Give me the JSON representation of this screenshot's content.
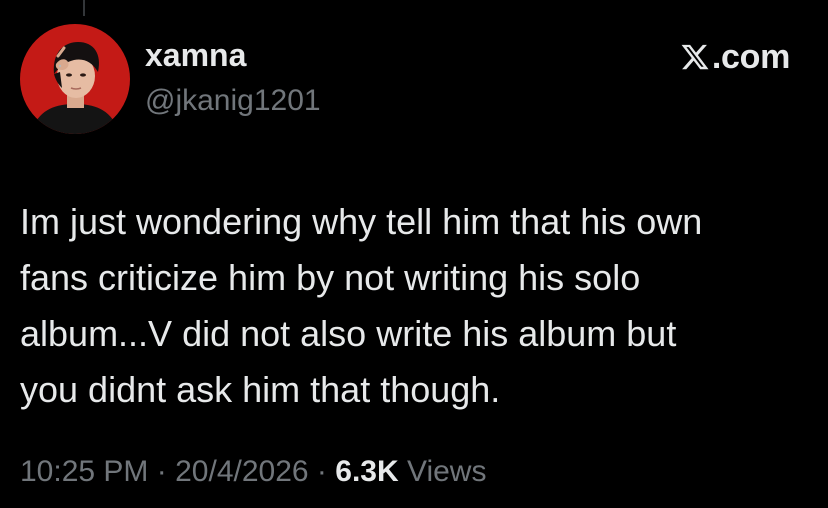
{
  "user": {
    "display_name": "xamna",
    "handle": "@jkanig1201"
  },
  "brand": {
    "label": ".com",
    "icon": "x-logo-icon"
  },
  "tweet": {
    "text": "Im just wondering why tell him that his own\nfans criticize him by not writing his solo\nalbum...V did not also write his album but\nyou didnt ask him that though."
  },
  "meta": {
    "time": "10:25 PM",
    "separator": "·",
    "date": "20/4/2026",
    "views_count": "6.3K",
    "views_label": "Views"
  },
  "colors": {
    "background": "#000000",
    "primary_text": "#e7e9ea",
    "secondary_text": "#71767b",
    "avatar_backdrop": "#c41a16"
  }
}
